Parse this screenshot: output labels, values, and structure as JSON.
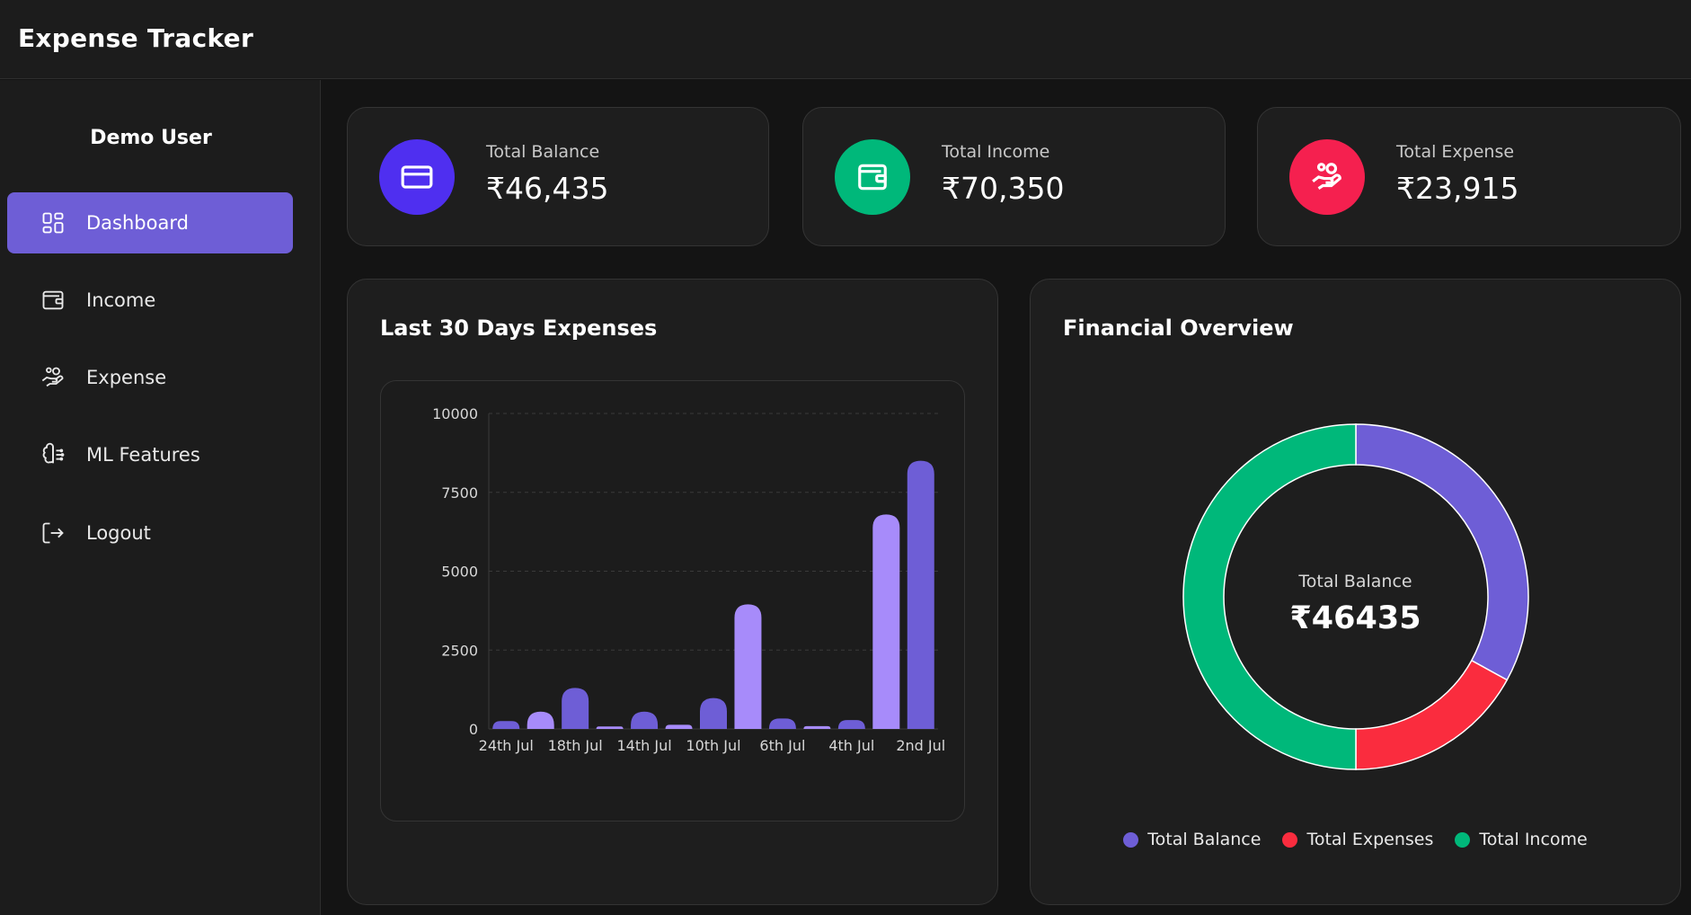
{
  "app": {
    "title": "Expense Tracker"
  },
  "sidebar": {
    "user_name": "Demo User",
    "items": [
      {
        "label": "Dashboard",
        "icon": "dashboard-icon",
        "active": true
      },
      {
        "label": "Income",
        "icon": "wallet-icon",
        "active": false
      },
      {
        "label": "Expense",
        "icon": "hand-coins-icon",
        "active": false
      },
      {
        "label": "ML Features",
        "icon": "brain-icon",
        "active": false
      },
      {
        "label": "Logout",
        "icon": "logout-icon",
        "active": false
      }
    ]
  },
  "stats": {
    "balance": {
      "label": "Total Balance",
      "value": "₹46,435",
      "color": "#4f2ff0",
      "icon": "credit-card-icon"
    },
    "income": {
      "label": "Total Income",
      "value": "₹70,350",
      "color": "#00b87a",
      "icon": "wallet-icon"
    },
    "expense": {
      "label": "Total Expense",
      "value": "₹23,915",
      "color": "#f5204f",
      "icon": "hand-coins-icon"
    }
  },
  "expenses_chart": {
    "title": "Last 30 Days Expenses",
    "chart_data": {
      "type": "bar",
      "categories": [
        "24th Jul",
        "",
        "18th Jul",
        "",
        "14th Jul",
        "",
        "10th Jul",
        "",
        "6th Jul",
        "",
        "4th Jul",
        "",
        "2nd Jul"
      ],
      "values": [
        250,
        550,
        1300,
        80,
        550,
        130,
        980,
        3950,
        330,
        90,
        280,
        6800,
        8500
      ],
      "bar_colors": [
        "#6e5ed6",
        "#a78bfa",
        "#6e5ed6",
        "#a78bfa",
        "#6e5ed6",
        "#a78bfa",
        "#6e5ed6",
        "#a78bfa",
        "#6e5ed6",
        "#a78bfa",
        "#6e5ed6",
        "#a78bfa",
        "#6e5ed6"
      ],
      "ylim": [
        0,
        10000
      ],
      "yticks": [
        "0",
        "2500",
        "5000",
        "7500",
        "10000"
      ],
      "grid": true
    }
  },
  "overview_chart": {
    "title": "Financial Overview",
    "center_label": "Total Balance",
    "center_value": "₹46435",
    "chart_data": {
      "type": "pie",
      "labels": [
        "Total Balance",
        "Total Expenses",
        "Total Income"
      ],
      "values": [
        46435,
        23915,
        70350
      ],
      "colors": [
        "#6e5ed6",
        "#fa2c3e",
        "#00b87a"
      ],
      "legend": "bottom"
    }
  }
}
